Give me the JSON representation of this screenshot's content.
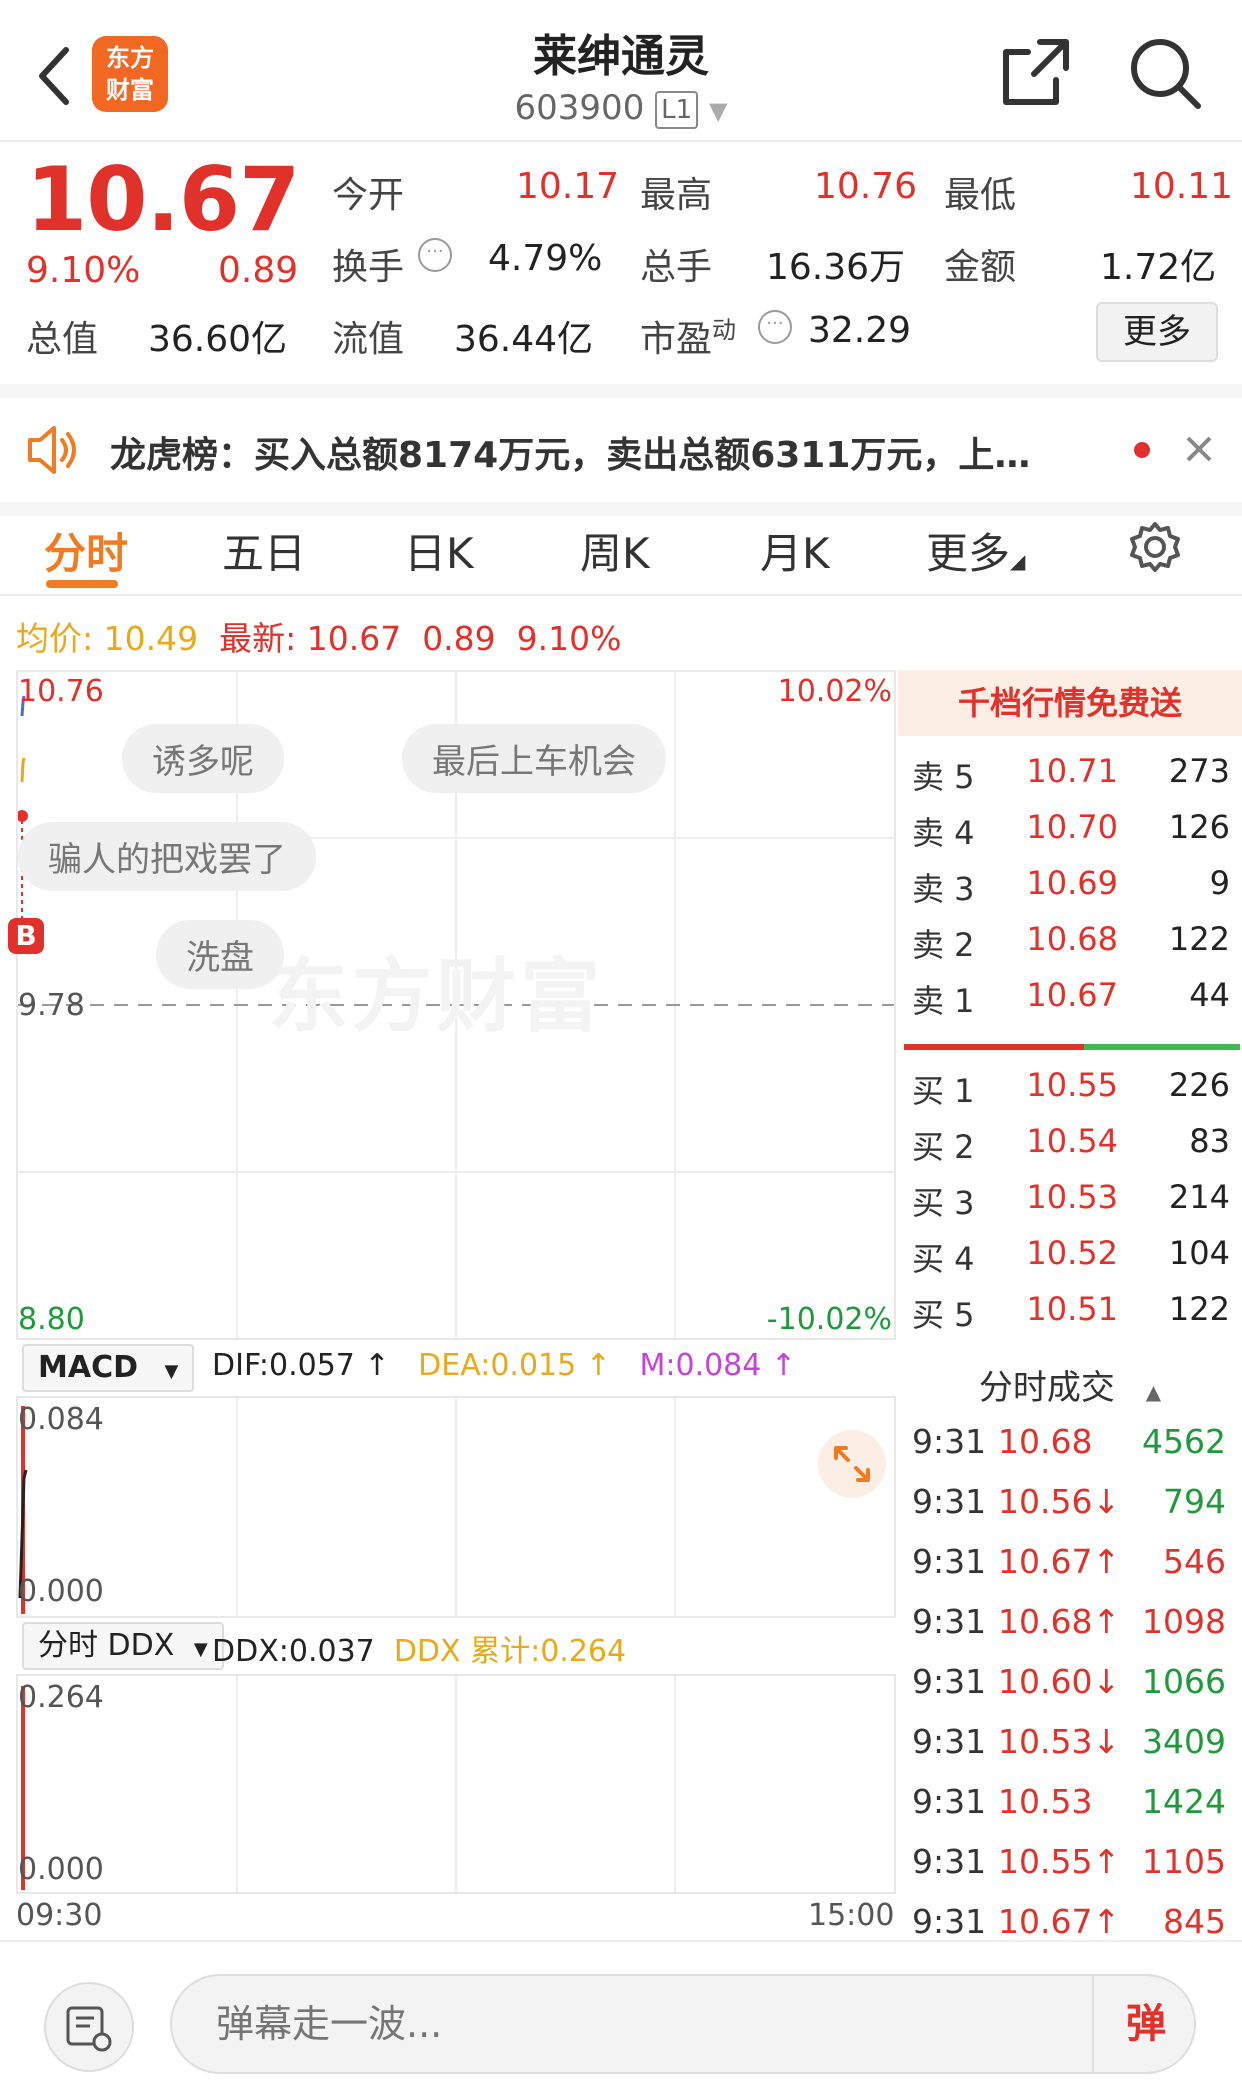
{
  "header": {
    "logo_line1": "东方",
    "logo_line2": "财富",
    "title": "莱绅通灵",
    "code": "603900",
    "level": "L1"
  },
  "quote": {
    "price": "10.67",
    "change_pct": "9.10%",
    "change": "0.89",
    "open_label": "今开",
    "open": "10.17",
    "high_label": "最高",
    "high": "10.76",
    "low_label": "最低",
    "low": "10.11",
    "turnover_label": "换手",
    "turnover": "4.79%",
    "volume_label": "总手",
    "volume": "16.36万",
    "amount_label": "金额",
    "amount": "1.72亿",
    "mktcap_label": "总值",
    "mktcap": "36.60亿",
    "float_label": "流值",
    "float": "36.44亿",
    "pe_label": "市盈",
    "pe_sup": "动",
    "pe": "32.29",
    "more_label": "更多"
  },
  "notice": {
    "text": "龙虎榜：买入总额8174万元，卖出总额6311万元，上…"
  },
  "tabs": [
    {
      "label": "分时"
    },
    {
      "label": "五日"
    },
    {
      "label": "日K"
    },
    {
      "label": "周K"
    },
    {
      "label": "月K"
    },
    {
      "label": "更多"
    }
  ],
  "infoline": {
    "avg_label": "均价:",
    "avg": "10.49",
    "latest_label": "最新:",
    "latest": "10.67",
    "change": "0.89",
    "change_pct": "9.10%"
  },
  "chart": {
    "y_top": "10.76",
    "y_mid": "9.78",
    "y_bottom": "8.80",
    "pct_top": "10.02%",
    "pct_bottom": "-10.02%",
    "marker": "B",
    "watermark": "东方财富",
    "x_start": "09:30",
    "x_end": "15:00",
    "danmu": [
      "诱多呢",
      "最后上车机会",
      "骗人的把戏罢了",
      "洗盘"
    ]
  },
  "macd": {
    "selector": "MACD",
    "dif": "DIF:0.057 ↑",
    "dea": "DEA:0.015 ↑",
    "m": "M:0.084 ↑",
    "y_top": "0.084",
    "y_bottom": "0.000"
  },
  "ddx": {
    "selector": "分时 DDX",
    "ddx": "DDX:0.037",
    "ddx_sum": "DDX 累计:0.264",
    "y_top": "0.264",
    "y_bottom": "0.000"
  },
  "orderbook": {
    "header": "千档行情免费送",
    "sells": [
      {
        "label": "卖 5",
        "price": "10.71",
        "vol": "273"
      },
      {
        "label": "卖 4",
        "price": "10.70",
        "vol": "126"
      },
      {
        "label": "卖 3",
        "price": "10.69",
        "vol": "9"
      },
      {
        "label": "卖 2",
        "price": "10.68",
        "vol": "122"
      },
      {
        "label": "卖 1",
        "price": "10.67",
        "vol": "44"
      }
    ],
    "buys": [
      {
        "label": "买 1",
        "price": "10.55",
        "vol": "226"
      },
      {
        "label": "买 2",
        "price": "10.54",
        "vol": "83"
      },
      {
        "label": "买 3",
        "price": "10.53",
        "vol": "214"
      },
      {
        "label": "买 4",
        "price": "10.52",
        "vol": "104"
      },
      {
        "label": "买 5",
        "price": "10.51",
        "vol": "122"
      }
    ]
  },
  "trades": {
    "header": "分时成交",
    "rows": [
      {
        "time": "9:31",
        "price": "10.68",
        "vol": "4562",
        "dir": "buy"
      },
      {
        "time": "9:31",
        "price": "10.56↓",
        "vol": "794",
        "dir": "sell"
      },
      {
        "time": "9:31",
        "price": "10.67↑",
        "vol": "546",
        "dir": "buy"
      },
      {
        "time": "9:31",
        "price": "10.68↑",
        "vol": "1098",
        "dir": "buy"
      },
      {
        "time": "9:31",
        "price": "10.60↓",
        "vol": "1066",
        "dir": "sell"
      },
      {
        "time": "9:31",
        "price": "10.53↓",
        "vol": "3409",
        "dir": "sell"
      },
      {
        "time": "9:31",
        "price": "10.53",
        "vol": "1424",
        "dir": "sell"
      },
      {
        "time": "9:31",
        "price": "10.55↑",
        "vol": "1105",
        "dir": "buy"
      },
      {
        "time": "9:31",
        "price": "10.67↑",
        "vol": "845",
        "dir": "buy"
      }
    ]
  },
  "bottom": {
    "input_placeholder": "弹幕走一波...",
    "send_label": "弹"
  },
  "colors": {
    "up": "#e0312b",
    "down": "#1e9a3c",
    "accent": "#f07b22"
  }
}
